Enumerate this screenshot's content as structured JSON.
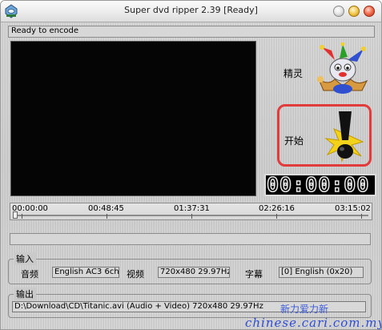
{
  "window": {
    "title": "Super dvd ripper 2.39 [Ready]"
  },
  "status": {
    "text": "Ready to encode"
  },
  "side": {
    "wizard_label": "精灵",
    "start_label": "开始"
  },
  "timecode": {
    "display": "00:00:00 0"
  },
  "timeline": {
    "marks": [
      "00:00:00",
      "00:48:45",
      "01:37:31",
      "02:26:16",
      "03:15:02"
    ]
  },
  "progress": {
    "fraction": 0
  },
  "input_group": {
    "title": "输入",
    "audio_label": "音频",
    "audio_value": "English AC3 6ch",
    "video_label": "视频",
    "video_value": "720x480 29.97Hz",
    "subtitle_label": "字幕",
    "subtitle_value": "[0] English (0x20)"
  },
  "output_group": {
    "title": "输出",
    "path": "D:\\Download\\CD\\Titanic.avi (Audio + Video) 720x480 29.97Hz"
  },
  "watermark": {
    "chinese": "新力爱力新",
    "url": "chinese.cari.com.my"
  },
  "colors": {
    "highlight_border": "#e23b3b",
    "watermark": "#2e4cd0"
  },
  "icons": [
    "dvd-ripper-app-icon",
    "minimize-icon",
    "maximize-icon",
    "close-icon",
    "jester-wizard-icon",
    "exclamation-start-icon"
  ]
}
